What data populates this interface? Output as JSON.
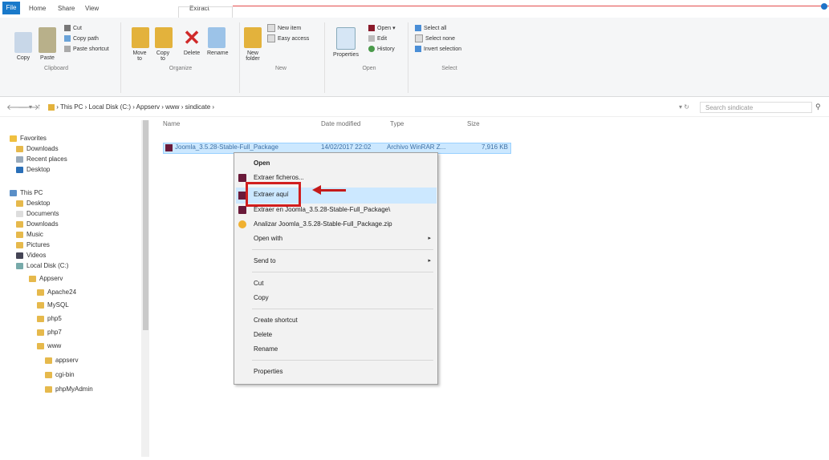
{
  "tabs": {
    "file": "File",
    "home": "Home",
    "share": "Share",
    "view": "View",
    "extract": "Extract"
  },
  "ribbon": {
    "clipboard": {
      "copy": "Copy",
      "paste": "Paste",
      "cut": "Cut",
      "copy_path": "Copy path",
      "paste_shortcut": "Paste shortcut",
      "label": "Clipboard"
    },
    "organize": {
      "move_to": "Move to",
      "copy_to": "Copy to",
      "delete": "Delete",
      "rename": "Rename",
      "label": "Organize"
    },
    "new": {
      "new_folder": "New folder",
      "new_item": "New item",
      "easy_access": "Easy access",
      "label": "New"
    },
    "open": {
      "properties": "Properties",
      "open": "Open",
      "edit": "Edit",
      "history": "History",
      "label": "Open"
    },
    "select": {
      "select_all": "Select all",
      "select_none": "Select none",
      "invert": "Invert selection",
      "label": "Select"
    }
  },
  "address": {
    "path": [
      "This PC",
      "Local Disk (C:)",
      "Appserv",
      "www",
      "sindicate"
    ],
    "search_placeholder": "Search sindicate"
  },
  "nav": {
    "items": [
      "Favorites",
      "Downloads",
      "Recent places",
      "Desktop",
      "This PC",
      "Desktop",
      "Documents",
      "Downloads",
      "Music",
      "Pictures",
      "Videos",
      "Local Disk (C:)",
      "Appserv",
      "Apache24",
      "MySQL",
      "php5",
      "php7",
      "www",
      "appserv",
      "cgi-bin",
      "phpMyAdmin"
    ]
  },
  "columns": {
    "name": "Name",
    "date": "Date modified",
    "type": "Type",
    "size": "Size"
  },
  "file": {
    "name": "Joomla_3.5.28-Stable-Full_Package",
    "date": "14/02/2017 22:02",
    "type": "Archivo WinRAR Z...",
    "size": "7,916 KB"
  },
  "context_menu": {
    "items": [
      "Open",
      "Extraer ficheros...",
      "Extraer aquí",
      "Extraer en Joomla_3.5.28-Stable-Full_Package\\",
      "Analizar Joomla_3.5.28-Stable-Full_Package.zip",
      "Open with",
      "Send to",
      "Cut",
      "Copy",
      "Create shortcut",
      "Delete",
      "Rename",
      "Properties"
    ]
  },
  "colors": {
    "accent": "#1979ca",
    "highlight": "#cce8ff",
    "annotation": "#d11e1e"
  }
}
